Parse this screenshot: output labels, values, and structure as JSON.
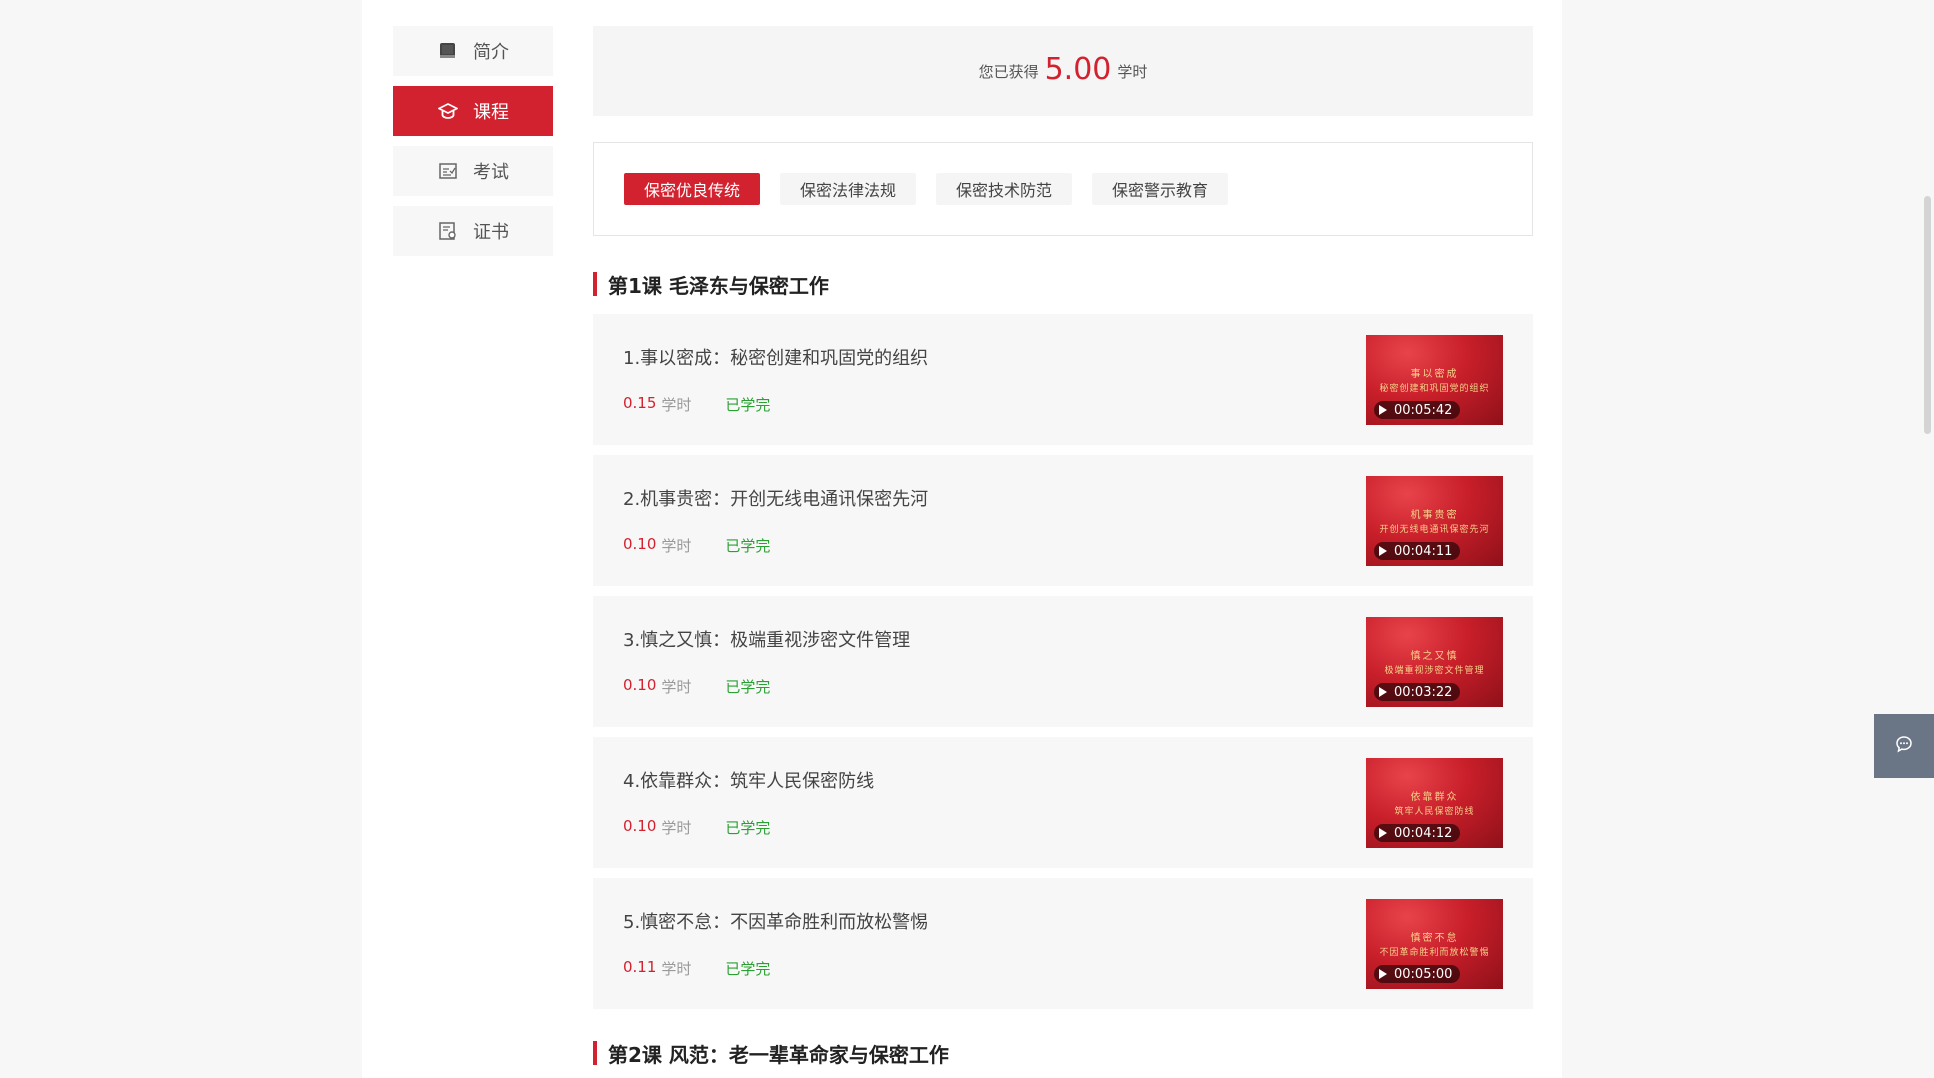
{
  "sidebar": {
    "items": [
      {
        "label": "简介",
        "icon": "book-icon"
      },
      {
        "label": "课程",
        "icon": "graduation-cap-icon"
      },
      {
        "label": "考试",
        "icon": "exam-icon"
      },
      {
        "label": "证书",
        "icon": "certificate-icon"
      }
    ],
    "active_index": 1
  },
  "hours": {
    "prefix": "您已获得",
    "value": "5.00",
    "unit": "学时"
  },
  "tabs": [
    {
      "label": "保密优良传统"
    },
    {
      "label": "保密法律法规"
    },
    {
      "label": "保密技术防范"
    },
    {
      "label": "保密警示教育"
    }
  ],
  "sections": [
    {
      "title": "第1课 毛泽东与保密工作",
      "lessons": [
        {
          "title": "1.事以密成：秘密创建和巩固党的组织",
          "hours": "0.15",
          "unit": "学时",
          "status": "已学完",
          "duration": "00:05:42",
          "cap1": "事以密成",
          "cap2": "秘密创建和巩固党的组织"
        },
        {
          "title": "2.机事贵密：开创无线电通讯保密先河",
          "hours": "0.10",
          "unit": "学时",
          "status": "已学完",
          "duration": "00:04:11",
          "cap1": "机事贵密",
          "cap2": "开创无线电通讯保密先河"
        },
        {
          "title": "3.慎之又慎：极端重视涉密文件管理",
          "hours": "0.10",
          "unit": "学时",
          "status": "已学完",
          "duration": "00:03:22",
          "cap1": "慎之又慎",
          "cap2": "极端重视涉密文件管理"
        },
        {
          "title": "4.依靠群众：筑牢人民保密防线",
          "hours": "0.10",
          "unit": "学时",
          "status": "已学完",
          "duration": "00:04:12",
          "cap1": "依靠群众",
          "cap2": "筑牢人民保密防线"
        },
        {
          "title": "5.慎密不怠：不因革命胜利而放松警惕",
          "hours": "0.11",
          "unit": "学时",
          "status": "已学完",
          "duration": "00:05:00",
          "cap1": "慎密不怠",
          "cap2": "不因革命胜利而放松警惕"
        }
      ]
    },
    {
      "title": "第2课 风范：老一辈革命家与保密工作"
    }
  ],
  "colors": {
    "accent": "#d3222f",
    "done": "#2aa033",
    "chat_button": "#6a7686"
  },
  "chat": {
    "icon": "chat-bubble-icon"
  }
}
